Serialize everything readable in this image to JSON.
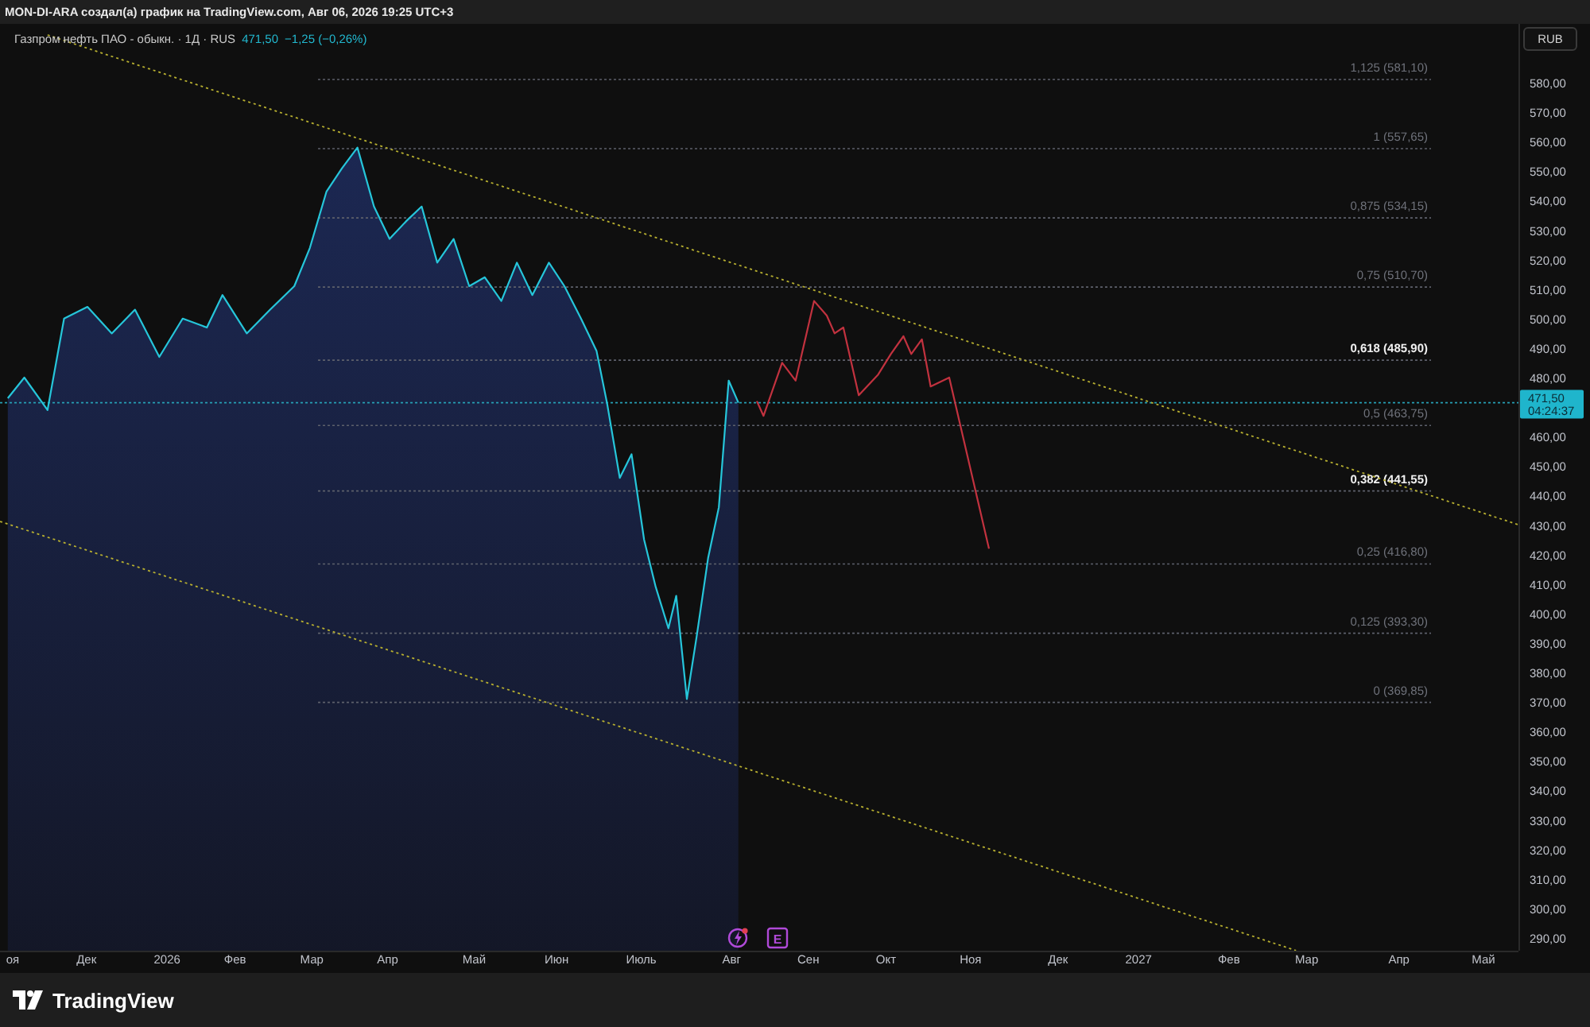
{
  "header": {
    "text": "MON-DI-ARA создал(а) график на TradingView.com, Авг 06, 2026 19:25 UTC+3"
  },
  "legend": {
    "symbol": "Газпром нефть ПАО - обыкн. · 1Д · RUS",
    "price": "471,50",
    "change": "−1,25 (−0,26%)"
  },
  "currency_button": "RUB",
  "chart": {
    "chart_data": {
      "type": "line",
      "xlim": [
        2025.828,
        2027.391
      ],
      "ylim": [
        285.66,
        599.95
      ],
      "x": [
        2025.828,
        2025.836,
        2025.853,
        2025.877,
        2025.894,
        2025.918,
        2025.943,
        2025.967,
        2025.992,
        2026.016,
        2026.041,
        2026.057,
        2026.082,
        2026.106,
        2026.131,
        2026.147,
        2026.164,
        2026.18,
        2026.196,
        2026.213,
        2026.229,
        2026.246,
        2026.262,
        2026.278,
        2026.295,
        2026.311,
        2026.327,
        2026.344,
        2026.36,
        2026.376,
        2026.393,
        2026.409,
        2026.426,
        2026.442,
        2026.453,
        2026.466,
        2026.478,
        2026.491,
        2026.503,
        2026.516,
        2026.524,
        2026.535,
        2026.545,
        2026.557,
        2026.568,
        2026.578,
        2026.588,
        2026.607,
        2026.614,
        2026.633,
        2026.647,
        2026.666,
        2026.679,
        2026.687,
        2026.696,
        2026.712,
        2026.732,
        2026.745,
        2026.758,
        2026.766,
        2026.777,
        2026.786,
        2026.805,
        2026.846,
        2027.162,
        2027.391
      ],
      "series": [
        {
          "color": "#26c6da",
          "values": [
            null,
            473,
            480,
            469,
            500,
            504,
            495,
            503,
            487,
            500,
            497,
            508,
            495,
            503,
            511,
            524,
            543,
            551,
            558,
            538,
            527,
            533,
            538,
            519,
            527,
            511,
            514,
            506,
            519,
            508,
            519,
            511,
            500,
            489,
            471,
            446,
            454,
            425,
            409,
            395,
            406,
            371,
            392,
            419,
            436,
            479,
            471.5,
            null,
            null,
            null,
            null,
            null,
            null,
            null,
            null,
            null,
            null,
            null,
            null,
            null,
            null,
            null,
            null,
            null,
            null,
            null
          ]
        },
        {
          "color": "#c2323f",
          "values": [
            null,
            null,
            null,
            null,
            null,
            null,
            null,
            null,
            null,
            null,
            null,
            null,
            null,
            null,
            null,
            null,
            null,
            null,
            null,
            null,
            null,
            null,
            null,
            null,
            null,
            null,
            null,
            null,
            null,
            null,
            null,
            null,
            null,
            null,
            null,
            null,
            null,
            null,
            null,
            null,
            null,
            null,
            null,
            null,
            null,
            null,
            null,
            472,
            467,
            485,
            479,
            506,
            501,
            495,
            497,
            474,
            481,
            488,
            494,
            488,
            493,
            477,
            480,
            422,
            null,
            null
          ]
        },
        {
          "color": "#b8b030",
          "line_style": "dotted",
          "values": [
            null,
            null,
            null,
            596.2,
            null,
            null,
            null,
            null,
            null,
            null,
            null,
            null,
            null,
            null,
            null,
            null,
            null,
            null,
            null,
            null,
            null,
            null,
            null,
            null,
            null,
            null,
            null,
            null,
            null,
            null,
            null,
            null,
            null,
            null,
            null,
            null,
            null,
            null,
            null,
            null,
            null,
            null,
            null,
            null,
            null,
            null,
            null,
            null,
            null,
            null,
            null,
            null,
            null,
            null,
            null,
            null,
            null,
            null,
            null,
            null,
            null,
            null,
            null,
            null,
            null,
            430.1
          ]
        },
        {
          "color": "#b8b030",
          "line_style": "dotted",
          "values": [
            431.2,
            null,
            null,
            null,
            null,
            null,
            null,
            null,
            null,
            null,
            null,
            null,
            null,
            null,
            null,
            null,
            null,
            null,
            null,
            null,
            null,
            null,
            null,
            null,
            null,
            null,
            null,
            null,
            null,
            null,
            null,
            null,
            null,
            null,
            null,
            null,
            null,
            null,
            null,
            null,
            null,
            null,
            null,
            null,
            null,
            null,
            null,
            null,
            null,
            null,
            null,
            null,
            null,
            null,
            null,
            null,
            null,
            null,
            null,
            null,
            null,
            null,
            null,
            null,
            285.7,
            null
          ]
        }
      ],
      "xticks": [
        {
          "value": 2025.841,
          "label": "оя"
        },
        {
          "value": 2025.917,
          "label": "Дек"
        },
        {
          "value": 2026,
          "label": "2026"
        },
        {
          "value": 2026.07,
          "label": "Фев"
        },
        {
          "value": 2026.149,
          "label": "Мар"
        },
        {
          "value": 2026.227,
          "label": "Апр"
        },
        {
          "value": 2026.316,
          "label": "Май"
        },
        {
          "value": 2026.401,
          "label": "Июн"
        },
        {
          "value": 2026.488,
          "label": "Июль"
        },
        {
          "value": 2026.581,
          "label": "Авг"
        },
        {
          "value": 2026.66,
          "label": "Сен"
        },
        {
          "value": 2026.74,
          "label": "Окт"
        },
        {
          "value": 2026.827,
          "label": "Ноя"
        },
        {
          "value": 2026.917,
          "label": "Дек"
        },
        {
          "value": 2027,
          "label": "2027"
        },
        {
          "value": 2027.093,
          "label": "Фев"
        },
        {
          "value": 2027.173,
          "label": "Мар"
        },
        {
          "value": 2027.268,
          "label": "Апр"
        },
        {
          "value": 2027.355,
          "label": "Май"
        }
      ],
      "yticks": [
        {
          "value": 580,
          "label": "580,00"
        },
        {
          "value": 570,
          "label": "570,00"
        },
        {
          "value": 560,
          "label": "560,00"
        },
        {
          "value": 550,
          "label": "550,00"
        },
        {
          "value": 540,
          "label": "540,00"
        },
        {
          "value": 530,
          "label": "530,00"
        },
        {
          "value": 520,
          "label": "520,00"
        },
        {
          "value": 510,
          "label": "510,00"
        },
        {
          "value": 500,
          "label": "500,00"
        },
        {
          "value": 490,
          "label": "490,00"
        },
        {
          "value": 480,
          "label": "480,00"
        },
        {
          "value": 460,
          "label": "460,00"
        },
        {
          "value": 450,
          "label": "450,00"
        },
        {
          "value": 440,
          "label": "440,00"
        },
        {
          "value": 430,
          "label": "430,00"
        },
        {
          "value": 420,
          "label": "420,00"
        },
        {
          "value": 410,
          "label": "410,00"
        },
        {
          "value": 400,
          "label": "400,00"
        },
        {
          "value": 390,
          "label": "390,00"
        },
        {
          "value": 380,
          "label": "380,00"
        },
        {
          "value": 370,
          "label": "370,00"
        },
        {
          "value": 360,
          "label": "360,00"
        },
        {
          "value": 350,
          "label": "350,00"
        },
        {
          "value": 340,
          "label": "340,00"
        },
        {
          "value": 330,
          "label": "330,00"
        },
        {
          "value": 320,
          "label": "320,00"
        },
        {
          "value": 310,
          "label": "310,00"
        },
        {
          "value": 300,
          "label": "300,00"
        },
        {
          "value": 290,
          "label": "290,00"
        }
      ],
      "ref_lines": [
        {
          "axis": "y",
          "value": 581.1,
          "label": "1,125 (581,10)"
        },
        {
          "axis": "y",
          "value": 557.65,
          "label": "1 (557,65)"
        },
        {
          "axis": "y",
          "value": 534.15,
          "label": "0,875 (534,15)"
        },
        {
          "axis": "y",
          "value": 510.7,
          "label": "0,75 (510,70)"
        },
        {
          "axis": "y",
          "value": 485.9,
          "label": "0,618 (485,90)"
        },
        {
          "axis": "y",
          "value": 463.75,
          "label": "0,5 (463,75)"
        },
        {
          "axis": "y",
          "value": 441.55,
          "label": "0,382 (441,55)"
        },
        {
          "axis": "y",
          "value": 416.8,
          "label": "0,25 (416,80)"
        },
        {
          "axis": "y",
          "value": 393.3,
          "label": "0,125 (393,30)"
        },
        {
          "axis": "y",
          "value": 369.85,
          "label": "0 (369,85)"
        },
        {
          "axis": "y",
          "value": 471.5,
          "color": "#26a0b5",
          "line_style": "dotted"
        }
      ],
      "grid": false
    },
    "fib_levels": [
      {
        "emphasized": false
      },
      {
        "emphasized": false
      },
      {
        "emphasized": false
      },
      {
        "emphasized": false
      },
      {
        "emphasized": true
      },
      {
        "emphasized": false
      },
      {
        "emphasized": true
      },
      {
        "emphasized": false
      },
      {
        "emphasized": false
      },
      {
        "emphasized": false
      }
    ]
  },
  "price_tag": {
    "price": "471,50",
    "countdown": "04:24:37"
  },
  "event_markers": [
    {
      "kind": "flash"
    },
    {
      "kind": "earnings",
      "label": "E"
    }
  ],
  "footer": {
    "brand": "TradingView"
  }
}
